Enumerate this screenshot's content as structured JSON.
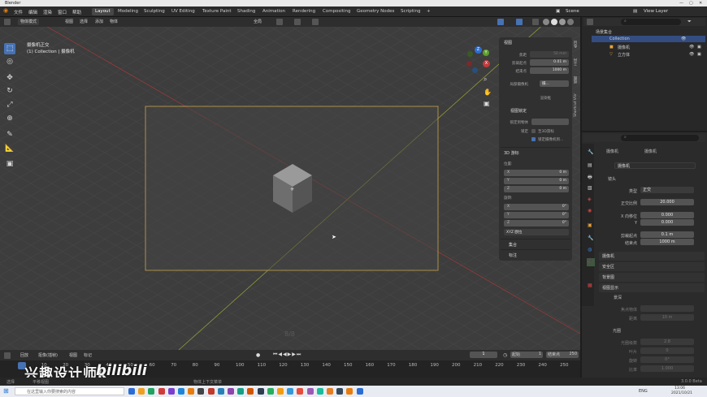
{
  "window": {
    "title": "Blender"
  },
  "menu": {
    "items": [
      "文件",
      "编辑",
      "渲染",
      "窗口",
      "帮助"
    ]
  },
  "workspaces": [
    "Layout",
    "Modeling",
    "Sculpting",
    "UV Editing",
    "Texture Paint",
    "Shading",
    "Animation",
    "Rendering",
    "Compositing",
    "Geometry Nodes",
    "Scripting",
    "+"
  ],
  "active_workspace": "Layout",
  "scene": {
    "name": "Scene",
    "view_layer": "View Layer"
  },
  "viewport_header": {
    "mode": "物体模式",
    "view": "视图",
    "select": "选择",
    "add": "添加",
    "object": "物体",
    "orientation": "全局"
  },
  "viewport_overlay": {
    "line1": "摄像机正交",
    "line2": "(1) Collection | 摄像机",
    "frame_counter": "8/8"
  },
  "npanel": {
    "view_title": "视图",
    "focal_label": "焦距",
    "focal_value": "50 mm",
    "clip_start_label": "剪裁起点",
    "clip_start_value": "0.01 m",
    "clip_end_label": "结束点",
    "clip_end_value": "1000 m",
    "local_camera_label": "局部摄像机",
    "local_camera_value": "摄...",
    "render_region_label": "渲染框",
    "view_lock_title": "视图锁定",
    "lock_to_object_label": "锁定到物体",
    "lock_label": "锁定",
    "lock_3d_cursor": "至3D游标",
    "lock_camera_to_view": "锁定摄像机到...",
    "cursor_title": "3D 游标",
    "location_label": "位置:",
    "rotation_label": "旋转:",
    "loc": [
      {
        "axis": "X",
        "value": "0 m"
      },
      {
        "axis": "Y",
        "value": "0 m"
      },
      {
        "axis": "Z",
        "value": "0 m"
      }
    ],
    "rot": [
      {
        "axis": "X",
        "value": "0°"
      },
      {
        "axis": "Y",
        "value": "0°"
      },
      {
        "axis": "Z",
        "value": "0°"
      }
    ],
    "rotation_mode": "XYZ 欧拉",
    "collections_title": "集合",
    "annotations_title": "标注"
  },
  "vtabs": [
    "条目",
    "工具",
    "视图",
    "Shortcut VUr"
  ],
  "outliner": {
    "search_placeholder": "",
    "root": "场景集合",
    "collection": "Collection",
    "items": [
      "摄像机",
      "立方体"
    ]
  },
  "properties": {
    "object_name": "摄像机",
    "data_name": "摄像机",
    "datablock": "摄像机",
    "lens_title": "镜头",
    "type_label": "类型",
    "type_value": "正交",
    "ortho_label": "正交比例",
    "ortho_value": "20.000",
    "shift_x_label": "X 向移位",
    "shift_x_value": "0.000",
    "shift_y_label": "Y",
    "shift_y_value": "0.000",
    "clip_start_label": "剪裁起点",
    "clip_start_value": "0.1 m",
    "clip_end_label": "结束点",
    "clip_end_value": "1000 m",
    "panels": [
      "摄像机",
      "安全区",
      "背景图",
      "视图显示"
    ],
    "dof_title": "景深",
    "focus_obj_label": "焦点物体",
    "distance_label": "距离",
    "distance_value": "10 m",
    "aperture_title": "光圈",
    "fstop_label": "光圈级数",
    "fstop_value": "2.8",
    "blades_label": "叶片",
    "blades_value": "0",
    "rotation_label": "旋转",
    "rotation_value": "0°",
    "ratio_label": "比率",
    "ratio_value": "1.000"
  },
  "timeline": {
    "playback": "回放",
    "keying": "抠像(插帧)",
    "view": "视图",
    "marker": "标记",
    "current_frame": "1",
    "start_label": "起始",
    "start_value": "1",
    "end_label": "结束点",
    "end_value": "250",
    "ticks": [
      "0",
      "10",
      "20",
      "30",
      "40",
      "50",
      "60",
      "70",
      "80",
      "90",
      "100",
      "110",
      "120",
      "130",
      "140",
      "150",
      "160",
      "170",
      "180",
      "190",
      "200",
      "210",
      "220",
      "230",
      "240",
      "250"
    ]
  },
  "status": {
    "hint": "物体上下文菜单",
    "version": "3.0.0 Beta",
    "left_a": "选择",
    "left_b": "平移视图"
  },
  "taskbar": {
    "search_placeholder": "在这里输入你要搜索的内容",
    "time": "13:06",
    "date": "2021/10/21",
    "lang": "ENG"
  },
  "watermark": {
    "text": "兴趣设计师k",
    "logo": "bilibili"
  },
  "colors": {
    "accent": "#4772b3",
    "selection": "#e8a43a"
  }
}
